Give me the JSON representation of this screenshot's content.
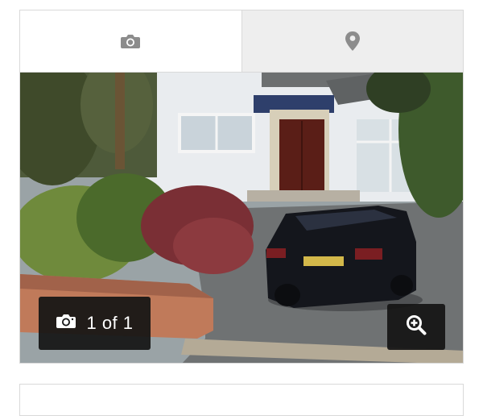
{
  "tabs": [
    {
      "icon": "camera-icon",
      "active": true
    },
    {
      "icon": "map-pin-icon",
      "active": false
    }
  ],
  "gallery": {
    "counter_icon": "camera-icon",
    "counter_text": "1 of 1",
    "zoom_icon": "zoom-in-icon"
  },
  "colors": {
    "tab_icon": "#8c8c8c",
    "overlay": "#141414",
    "border": "#d9d9d9"
  }
}
